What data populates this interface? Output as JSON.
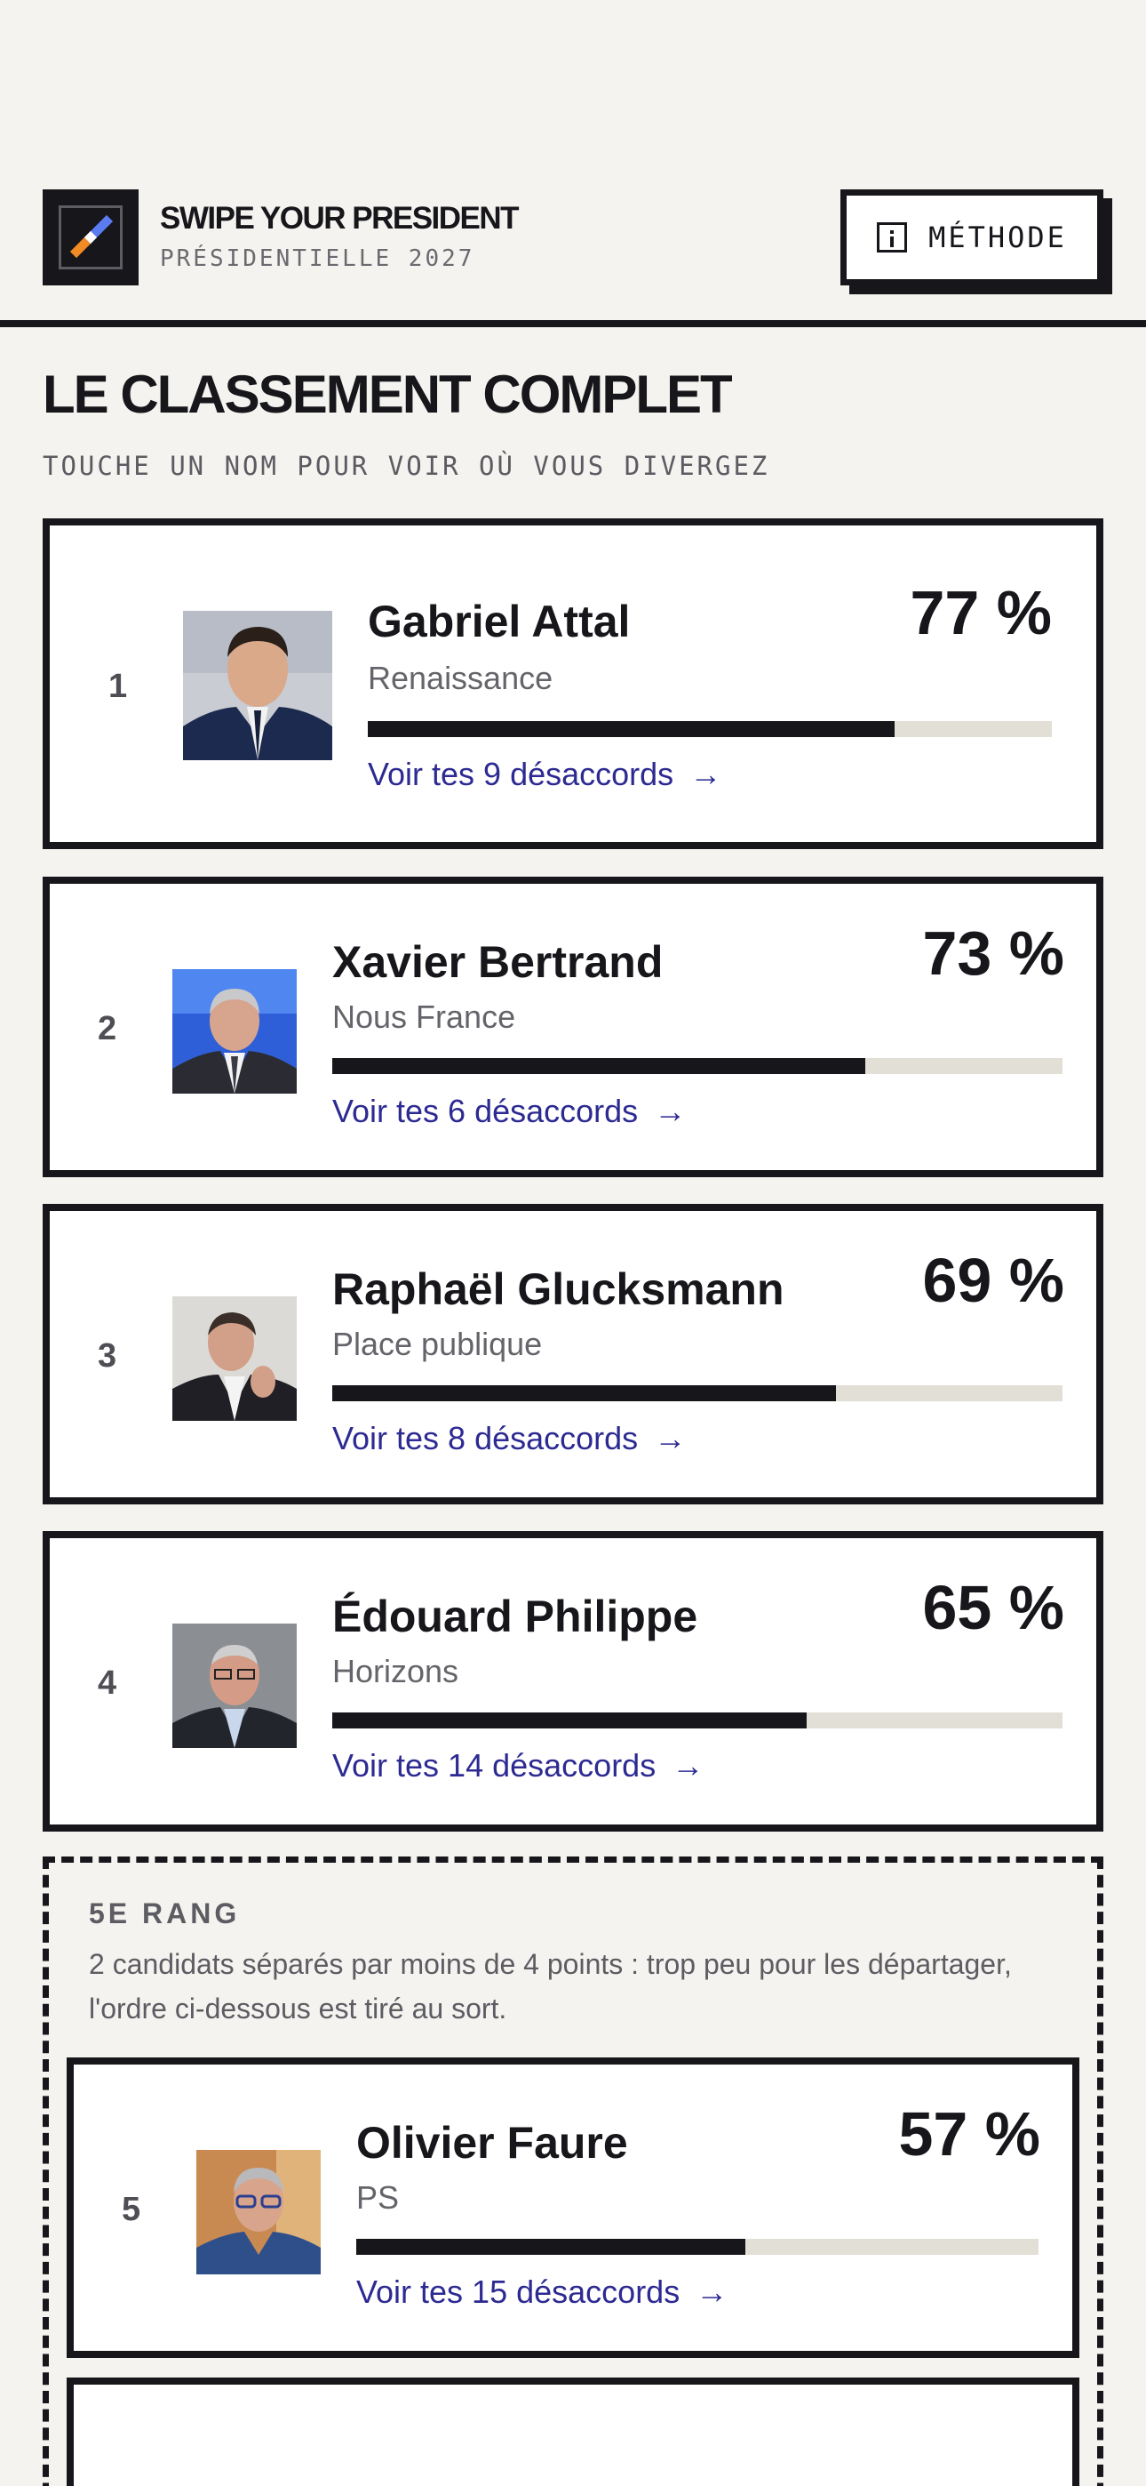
{
  "header": {
    "app_title": "SWIPE YOUR PRESIDENT",
    "subtitle": "PRÉSIDENTIELLE 2027",
    "method_button": "MÉTHODE"
  },
  "main": {
    "title": "LE CLASSEMENT COMPLET",
    "subtitle": "TOUCHE UN NOM POUR VOIR OÙ VOUS DIVERGEZ"
  },
  "candidates": [
    {
      "rank": "1",
      "name": "Gabriel Attal",
      "party": "Renaissance",
      "percent": "77 %",
      "score": 0.77,
      "link": "Voir tes 9 désaccords"
    },
    {
      "rank": "2",
      "name": "Xavier Bertrand",
      "party": "Nous France",
      "percent": "73 %",
      "score": 0.73,
      "link": "Voir tes 6 désaccords"
    },
    {
      "rank": "3",
      "name": "Raphaël Glucksmann",
      "party": "Place publique",
      "percent": "69 %",
      "score": 0.69,
      "link": "Voir tes 8 désaccords"
    },
    {
      "rank": "4",
      "name": "Édouard Philippe",
      "party": "Horizons",
      "percent": "65 %",
      "score": 0.65,
      "link": "Voir tes 14 désaccords"
    },
    {
      "rank": "5",
      "name": "Olivier Faure",
      "party": "PS",
      "percent": "57 %",
      "score": 0.57,
      "link": "Voir tes 15 désaccords"
    }
  ],
  "tie_group": {
    "label": "5E RANG",
    "description": "2 candidats séparés par moins de 4 points : trop peu pour les départager, l'ordre ci-dessous est tiré au sort."
  },
  "icons": {
    "logo": "swipe-logo-icon",
    "method": "info-icon",
    "link_arrow": "arrow-right-icon"
  },
  "colors": {
    "ink": "#17161b",
    "background": "#f4f3ef",
    "link": "#2d2a92",
    "bar_track": "#e2dfd6",
    "logo_orange": "#f08a24",
    "logo_blue": "#5b7bf0"
  }
}
